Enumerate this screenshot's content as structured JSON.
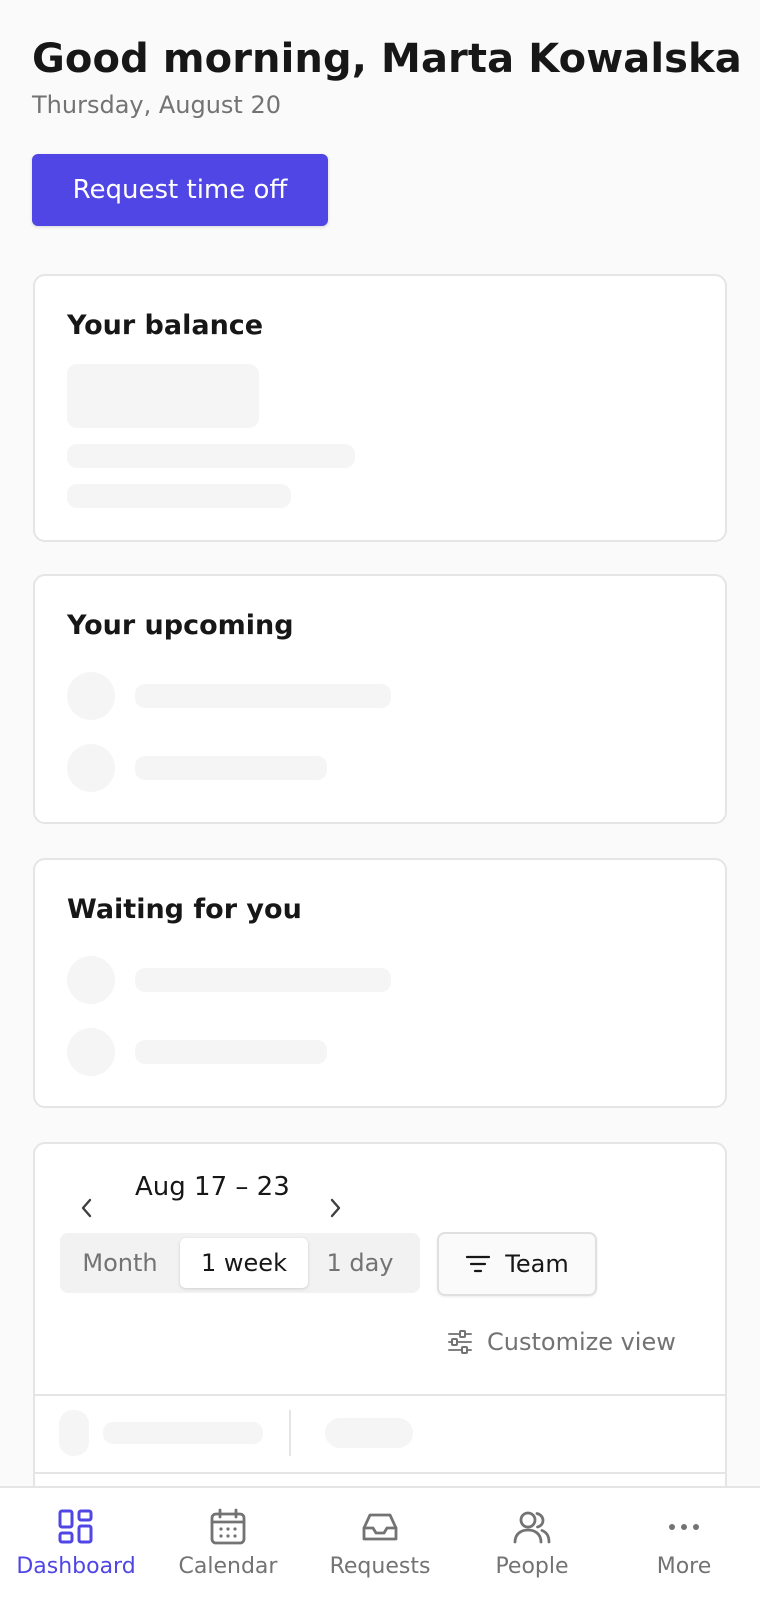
{
  "header": {
    "greeting": "Good morning, Marta Kowalska",
    "date": "Thursday, August 20",
    "request_button": "Request time off"
  },
  "cards": {
    "balance_title": "Your balance",
    "upcoming_title": "Your upcoming",
    "waiting_title": "Waiting for you"
  },
  "calendar": {
    "range": "Aug 17 – 23",
    "view_options": [
      "Month",
      "1 week",
      "1 day"
    ],
    "selected_view": "1 week",
    "team_button": "Team",
    "customize_label": "Customize view"
  },
  "bottom_nav": {
    "items": [
      {
        "label": "Dashboard",
        "icon": "dashboard-icon",
        "active": true
      },
      {
        "label": "Calendar",
        "icon": "calendar-icon",
        "active": false
      },
      {
        "label": "Requests",
        "icon": "inbox-icon",
        "active": false
      },
      {
        "label": "People",
        "icon": "people-icon",
        "active": false
      },
      {
        "label": "More",
        "icon": "more-icon",
        "active": false
      }
    ]
  },
  "colors": {
    "accent": "#4f46e5",
    "background": "#fafafa",
    "skeleton": "#f5f5f5",
    "border": "#e5e5e5",
    "muted_text": "#737373"
  }
}
